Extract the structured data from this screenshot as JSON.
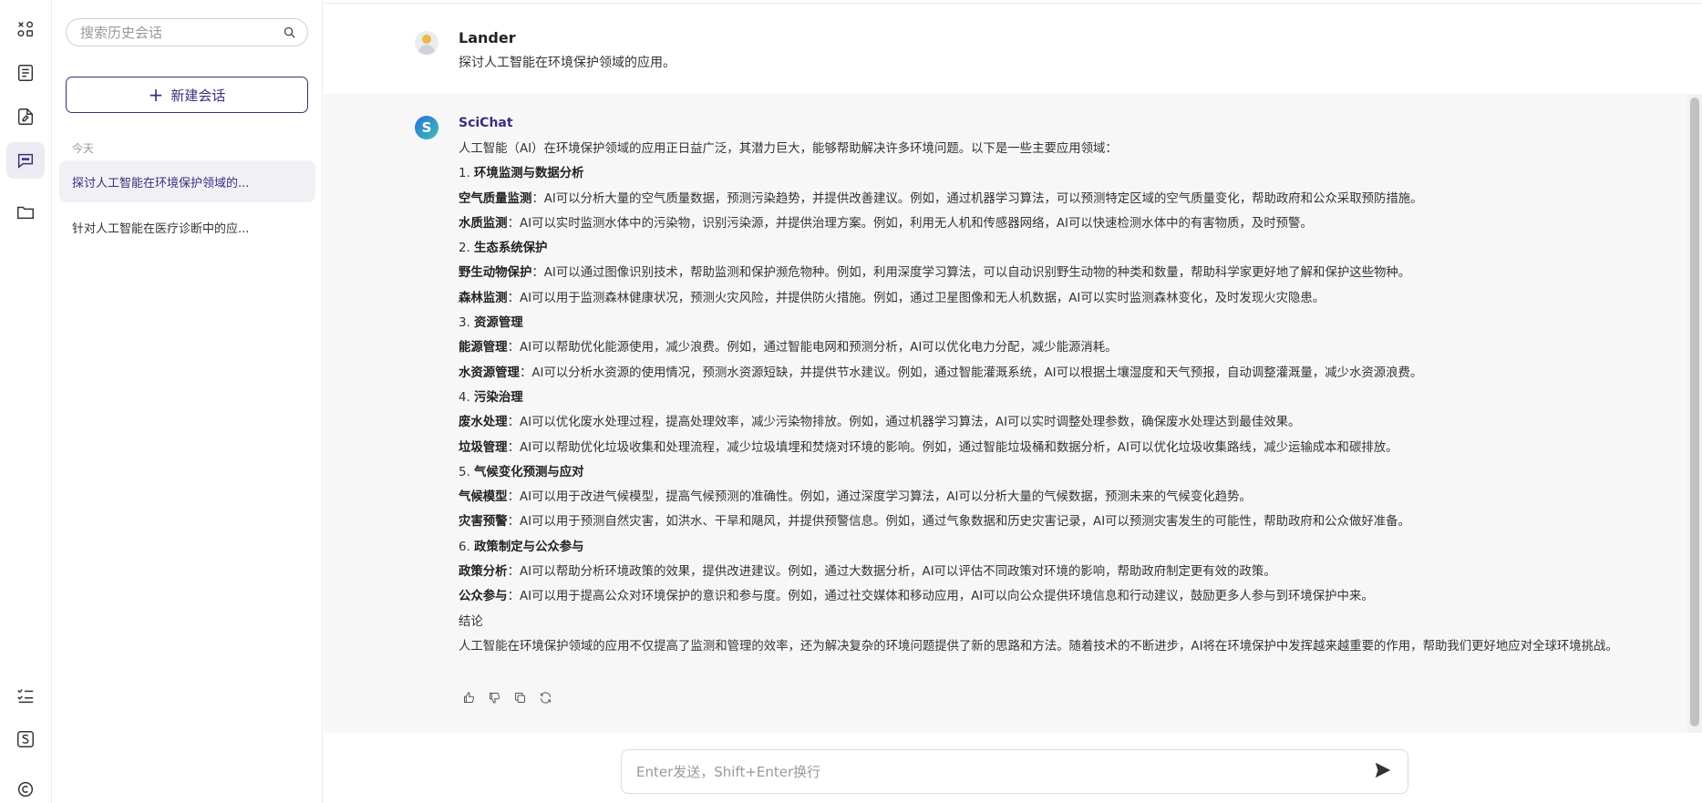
{
  "sidebar": {
    "rail_icons": [
      "apps-icon",
      "document-list-icon",
      "document-edit-icon",
      "chat-icon",
      "folder-icon"
    ],
    "bottom_icons": [
      "checklist-icon",
      "scichat-logo-icon",
      "copyright-icon"
    ]
  },
  "history": {
    "search_placeholder": "搜索历史会话",
    "new_chat_label": "新建会话",
    "section_today": "今天",
    "items": [
      {
        "label": "探讨人工智能在环境保护领域的...",
        "active": true
      },
      {
        "label": "针对人工智能在医疗诊断中的应...",
        "active": false
      }
    ]
  },
  "chat": {
    "user": {
      "name": "Lander",
      "message": "探讨人工智能在环境保护领域的应用。"
    },
    "assistant": {
      "name": "SciChat",
      "intro": "人工智能（AI）在环境保护领域的应用正日益广泛，其潜力巨大，能够帮助解决许多环境问题。以下是一些主要应用领域：",
      "sections": [
        {
          "num": "1. ",
          "title": "环境监测与数据分析",
          "items": [
            {
              "term": "空气质量监测",
              "text": "：AI可以分析大量的空气质量数据，预测污染趋势，并提供改善建议。例如，通过机器学习算法，可以预测特定区域的空气质量变化，帮助政府和公众采取预防措施。"
            },
            {
              "term": "水质监测",
              "text": "：AI可以实时监测水体中的污染物，识别污染源，并提供治理方案。例如，利用无人机和传感器网络，AI可以快速检测水体中的有害物质，及时预警。"
            }
          ]
        },
        {
          "num": "2. ",
          "title": "生态系统保护",
          "items": [
            {
              "term": "野生动物保护",
              "text": "：AI可以通过图像识别技术，帮助监测和保护濒危物种。例如，利用深度学习算法，可以自动识别野生动物的种类和数量，帮助科学家更好地了解和保护这些物种。"
            },
            {
              "term": "森林监测",
              "text": "：AI可以用于监测森林健康状况，预测火灾风险，并提供防火措施。例如，通过卫星图像和无人机数据，AI可以实时监测森林变化，及时发现火灾隐患。"
            }
          ]
        },
        {
          "num": "3. ",
          "title": "资源管理",
          "items": [
            {
              "term": "能源管理",
              "text": "：AI可以帮助优化能源使用，减少浪费。例如，通过智能电网和预测分析，AI可以优化电力分配，减少能源消耗。"
            },
            {
              "term": "水资源管理",
              "text": "：AI可以分析水资源的使用情况，预测水资源短缺，并提供节水建议。例如，通过智能灌溉系统，AI可以根据土壤湿度和天气预报，自动调整灌溉量，减少水资源浪费。"
            }
          ]
        },
        {
          "num": "4. ",
          "title": "污染治理",
          "items": [
            {
              "term": "废水处理",
              "text": "：AI可以优化废水处理过程，提高处理效率，减少污染物排放。例如，通过机器学习算法，AI可以实时调整处理参数，确保废水处理达到最佳效果。"
            },
            {
              "term": "垃圾管理",
              "text": "：AI可以帮助优化垃圾收集和处理流程，减少垃圾填埋和焚烧对环境的影响。例如，通过智能垃圾桶和数据分析，AI可以优化垃圾收集路线，减少运输成本和碳排放。"
            }
          ]
        },
        {
          "num": "5. ",
          "title": "气候变化预测与应对",
          "items": [
            {
              "term": "气候模型",
              "text": "：AI可以用于改进气候模型，提高气候预测的准确性。例如，通过深度学习算法，AI可以分析大量的气候数据，预测未来的气候变化趋势。"
            },
            {
              "term": "灾害预警",
              "text": "：AI可以用于预测自然灾害，如洪水、干旱和飓风，并提供预警信息。例如，通过气象数据和历史灾害记录，AI可以预测灾害发生的可能性，帮助政府和公众做好准备。"
            }
          ]
        },
        {
          "num": "6. ",
          "title": "政策制定与公众参与",
          "items": [
            {
              "term": "政策分析",
              "text": "：AI可以帮助分析环境政策的效果，提供改进建议。例如，通过大数据分析，AI可以评估不同政策对环境的影响，帮助政府制定更有效的政策。"
            },
            {
              "term": "公众参与",
              "text": "：AI可以用于提高公众对环境保护的意识和参与度。例如，通过社交媒体和移动应用，AI可以向公众提供环境信息和行动建议，鼓励更多人参与到环境保护中来。"
            }
          ]
        }
      ],
      "conclusion_title": "结论",
      "conclusion": "人工智能在环境保护领域的应用不仅提高了监测和管理的效率，还为解决复杂的环境问题提供了新的思路和方法。随着技术的不断进步，AI将在环境保护中发挥越来越重要的作用，帮助我们更好地应对全球环境挑战。"
    }
  },
  "composer": {
    "placeholder": "Enter发送，Shift+Enter换行"
  }
}
